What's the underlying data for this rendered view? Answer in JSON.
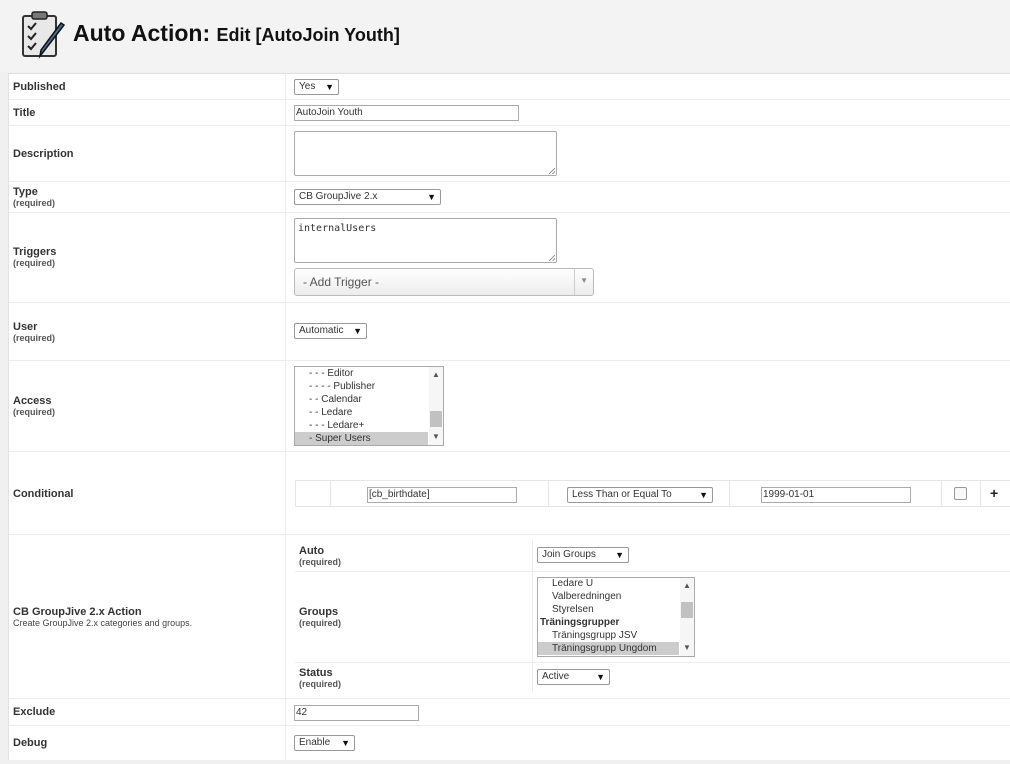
{
  "header": {
    "title_main": "Auto Action:",
    "title_sub": "Edit [AutoJoin Youth]",
    "icon": "checklist-pencil-icon"
  },
  "required_text": "(required)",
  "published": {
    "label": "Published",
    "value": "Yes"
  },
  "title_field": {
    "label": "Title",
    "value": "AutoJoin Youth"
  },
  "description": {
    "label": "Description",
    "value": ""
  },
  "type": {
    "label": "Type",
    "value": "CB GroupJive 2.x"
  },
  "triggers": {
    "label": "Triggers",
    "value": "internalUsers",
    "add_trigger": "- Add Trigger -"
  },
  "user": {
    "label": "User",
    "value": "Automatic"
  },
  "access": {
    "label": "Access",
    "items": [
      "- - - Editor",
      "- - - - Publisher",
      "- - Calendar",
      "- - Ledare",
      "- - - Ledare+",
      "- Super Users"
    ],
    "selected_index": 5
  },
  "conditional": {
    "label": "Conditional",
    "field": "[cb_birthdate]",
    "operator": "Less Than or Equal To",
    "value": "1999-01-01",
    "add_icon": "+"
  },
  "groupjive": {
    "label": "CB GroupJive 2.x Action",
    "description": "Create GroupJive 2.x categories and groups.",
    "auto": {
      "label": "Auto",
      "value": "Join Groups"
    },
    "groups": {
      "label": "Groups",
      "items": [
        {
          "text": "Ledare U",
          "group": false
        },
        {
          "text": "Valberedningen",
          "group": false
        },
        {
          "text": "Styrelsen",
          "group": false
        },
        {
          "text": "Träningsgrupper",
          "group": true
        },
        {
          "text": "Träningsgrupp JSV",
          "group": false
        },
        {
          "text": "Träningsgrupp Ungdom",
          "group": false
        }
      ],
      "selected_index": 5
    },
    "status": {
      "label": "Status",
      "value": "Active"
    }
  },
  "exclude": {
    "label": "Exclude",
    "value": "42"
  },
  "debug": {
    "label": "Debug",
    "value": "Enable"
  }
}
